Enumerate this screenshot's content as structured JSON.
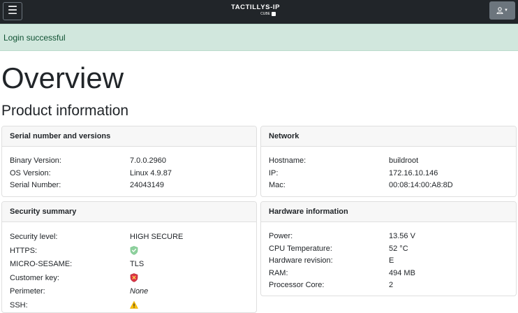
{
  "navbar": {
    "brand_main": "TACTILLYS-IP",
    "brand_sub": "CUBE"
  },
  "alert": {
    "text": "Login successful"
  },
  "page": {
    "title": "Overview",
    "section_title": "Product information"
  },
  "serial_card": {
    "title": "Serial number and versions",
    "rows": [
      {
        "label": "Binary Version:",
        "value": "7.0.0.2960"
      },
      {
        "label": "OS Version:",
        "value": "Linux 4.9.87"
      },
      {
        "label": "Serial Number:",
        "value": "24043149"
      }
    ]
  },
  "network_card": {
    "title": "Network",
    "rows": [
      {
        "label": "Hostname:",
        "value": "buildroot"
      },
      {
        "label": "IP:",
        "value": "172.16.10.146"
      },
      {
        "label": "Mac:",
        "value": "00:08:14:00:A8:8D"
      }
    ]
  },
  "security_card": {
    "title": "Security summary",
    "rows": [
      {
        "label": "Security level:",
        "value": "HIGH SECURE"
      },
      {
        "label": "HTTPS:",
        "icon": "shield-check-icon"
      },
      {
        "label": "MICRO-SESAME:",
        "value": "TLS"
      },
      {
        "label": "Customer key:",
        "icon": "shield-x-icon"
      },
      {
        "label": "Perimeter:",
        "value": "None"
      },
      {
        "label": "SSH:",
        "icon": "warning-triangle-icon"
      }
    ]
  },
  "hardware_card": {
    "title": "Hardware information",
    "rows": [
      {
        "label": "Power:",
        "value": "13.56 V"
      },
      {
        "label": "CPU Temperature:",
        "value": "52 °C"
      },
      {
        "label": "Hardware revision:",
        "value": "E"
      },
      {
        "label": "RAM:",
        "value": "494 MB"
      },
      {
        "label": "Processor Core:",
        "value": "2"
      }
    ]
  },
  "colors": {
    "navbar_bg": "#212529",
    "alert_bg": "#d1e7dd",
    "alert_text": "#0f5132",
    "shield_ok": "#8fd19e",
    "shield_bad": "#dc3545",
    "warning": "#ffc107"
  }
}
